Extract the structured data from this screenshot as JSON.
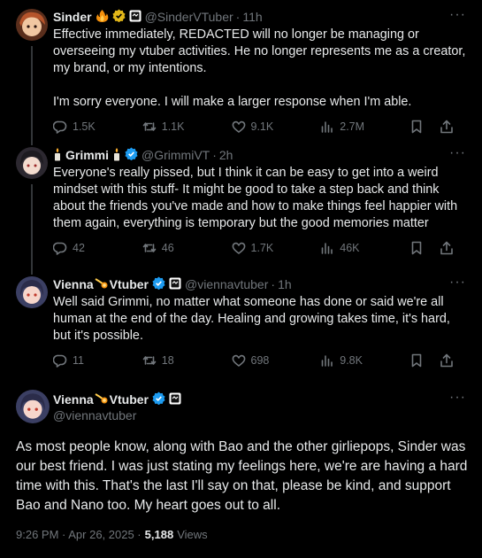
{
  "tweets": [
    {
      "name": "Sinder",
      "handle": "@SinderVTuber",
      "time": "11h",
      "text": "Effective immediately, REDACTED will no longer be managing or overseeing my vtuber activities. He no longer represents me as a creator, my brand, or my intentions.\n\nI'm sorry everyone. I will make a larger response when I'm able.",
      "replies": "1.5K",
      "retweets": "1.1K",
      "likes": "9.1K",
      "views": "2.7M"
    },
    {
      "name": "Grimmi",
      "handle": "@GrimmiVT",
      "time": "2h",
      "text": "Everyone's really pissed, but I think it can be easy to get into a weird mindset with this stuff- It might be good to take a step back and think about the friends you've made and how to make things feel happier with them again, everything is temporary but the good memories matter",
      "replies": "42",
      "retweets": "46",
      "likes": "1.7K",
      "views": "46K"
    },
    {
      "name": "Vienna",
      "name2": "Vtuber",
      "handle": "@viennavtuber",
      "time": "1h",
      "text": "Well said Grimmi, no matter what someone has done or said we're all human at the end of the day. Healing and growing takes time, it's hard, but it's possible.",
      "replies": "11",
      "retweets": "18",
      "likes": "698",
      "views": "9.8K"
    }
  ],
  "main": {
    "name": "Vienna",
    "name2": "Vtuber",
    "handle": "@viennavtuber",
    "text": "As most people know, along with Bao and the other girliepops, Sinder was our best friend. I was just stating my feelings here, we're are having a hard time with this. That's the last I'll say on that, please be kind, and support Bao and Nano too. My heart goes out to all.",
    "timestamp": "9:26 PM · Apr 26, 2025 ·",
    "views_count": "5,188",
    "views_label": "Views"
  },
  "ui": {
    "more_glyph": "···",
    "dot": "·"
  },
  "colors": {
    "background": "#000000",
    "text": "#e7e9ea",
    "muted": "#71767b",
    "verified": "#1d9bf0",
    "gold": "#e2b719"
  },
  "icons": [
    "reply-icon",
    "retweet-icon",
    "like-icon",
    "views-icon",
    "bookmark-icon",
    "share-icon",
    "more-icon",
    "verified-icon",
    "fire-icon",
    "candle-icon",
    "comet-icon"
  ]
}
